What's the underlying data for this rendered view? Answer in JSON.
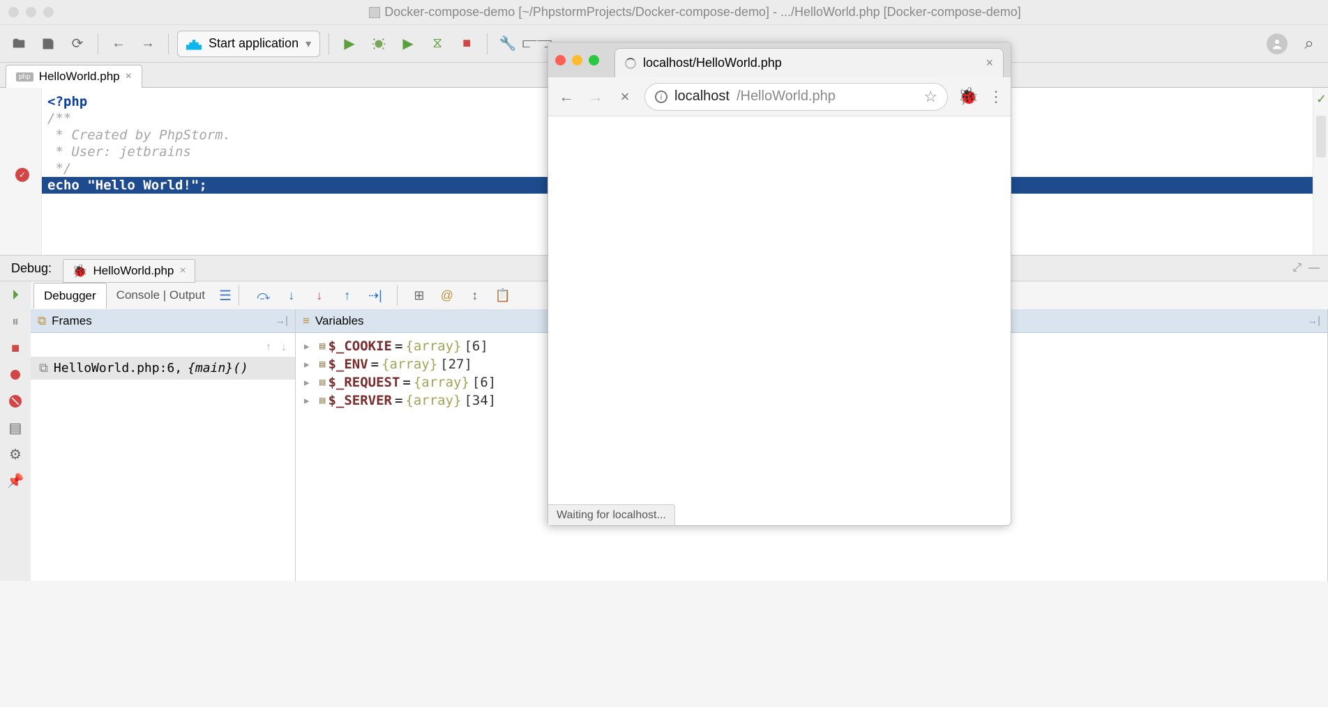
{
  "window": {
    "title": "Docker-compose-demo [~/PhpstormProjects/Docker-compose-demo] - .../HelloWorld.php [Docker-compose-demo]"
  },
  "toolbar": {
    "run_config": "Start application"
  },
  "editor": {
    "tab_name": "HelloWorld.php",
    "code": {
      "l1": "<?php",
      "l2": "/**",
      "l3": " * Created by PhpStorm.",
      "l4": " * User: jetbrains",
      "l5": " */",
      "l6": "echo \"Hello World!\";"
    }
  },
  "debug": {
    "label": "Debug:",
    "session": "HelloWorld.php",
    "tabs": {
      "debugger": "Debugger",
      "console": "Console | Output"
    },
    "frames": {
      "title": "Frames",
      "row": "HelloWorld.php:6, ",
      "fn": "{main}()"
    },
    "vars": {
      "title": "Variables",
      "items": [
        {
          "name": "$_COOKIE",
          "type": "{array}",
          "count": "[6]"
        },
        {
          "name": "$_ENV",
          "type": "{array}",
          "count": "[27]"
        },
        {
          "name": "$_REQUEST",
          "type": "{array}",
          "count": "[6]"
        },
        {
          "name": "$_SERVER",
          "type": "{array}",
          "count": "[34]"
        }
      ]
    }
  },
  "browser": {
    "tab_title": "localhost/HelloWorld.php",
    "url_host": "localhost",
    "url_path": "/HelloWorld.php",
    "status": "Waiting for localhost..."
  }
}
